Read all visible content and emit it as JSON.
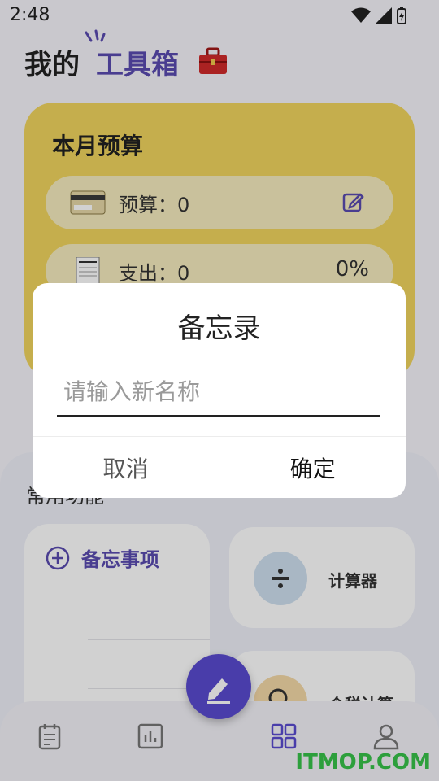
{
  "status": {
    "time": "2:48"
  },
  "header": {
    "title_part1": "我的",
    "title_part2": "工具箱"
  },
  "budget": {
    "title": "本月预算",
    "budget_label": "预算：0",
    "expense_label": "支出：0",
    "expense_percent": "0%"
  },
  "common": {
    "title": "常用功能",
    "memo_label": "备忘事项",
    "calculator_label": "计算器",
    "tax_label": "个税计算"
  },
  "dialog": {
    "title": "备忘录",
    "input_placeholder": "请输入新名称",
    "cancel_label": "取消",
    "confirm_label": "确定"
  },
  "watermark": "ITMOP.COM",
  "colors": {
    "accent": "#5a4bd0",
    "budget_card": "#f1d55e",
    "watermark": "#38c24a"
  }
}
